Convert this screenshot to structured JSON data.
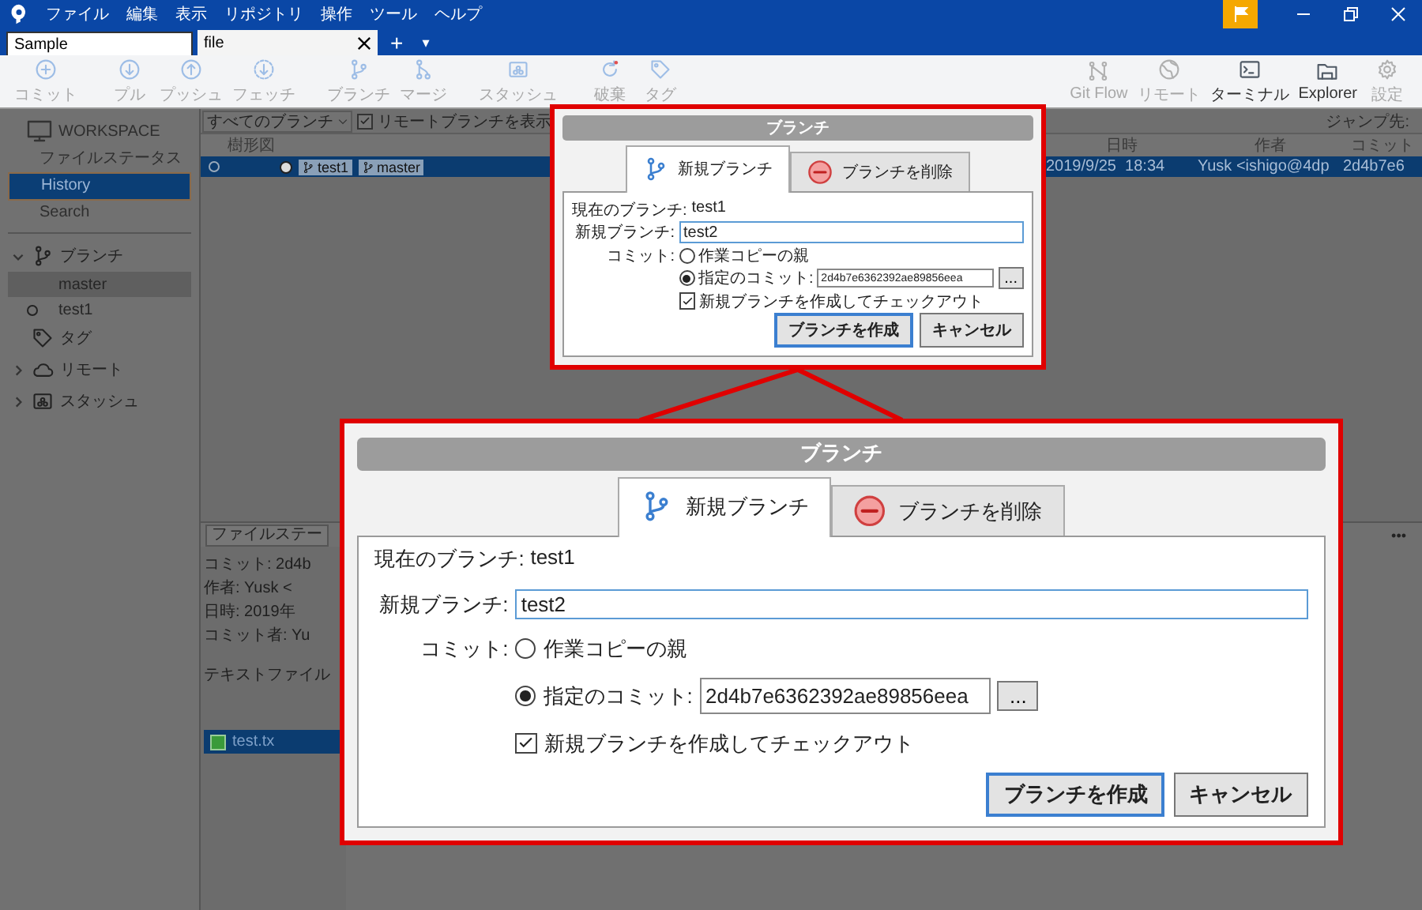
{
  "window": {
    "menu": [
      "ファイル",
      "編集",
      "表示",
      "リポジトリ",
      "操作",
      "ツール",
      "ヘルプ"
    ]
  },
  "tabs": [
    {
      "label": "Sample",
      "selected": false,
      "closable": false
    },
    {
      "label": "file",
      "selected": true,
      "closable": true
    }
  ],
  "tab_actions": [
    "+",
    "▾"
  ],
  "toolbar": {
    "groups": [
      [
        {
          "label": "コミット",
          "kind": "commit",
          "disabled": true
        }
      ],
      [
        {
          "label": "プル",
          "kind": "pull",
          "disabled": true
        },
        {
          "label": "プッシュ",
          "kind": "push",
          "disabled": true
        },
        {
          "label": "フェッチ",
          "kind": "fetch",
          "disabled": true
        }
      ],
      [
        {
          "label": "ブランチ",
          "kind": "branch",
          "disabled": true
        },
        {
          "label": "マージ",
          "kind": "merge",
          "disabled": true
        }
      ],
      [
        {
          "label": "スタッシュ",
          "kind": "stash",
          "disabled": true
        }
      ],
      [
        {
          "label": "破棄",
          "kind": "discard",
          "disabled": true
        },
        {
          "label": "タグ",
          "kind": "tag",
          "disabled": true
        }
      ]
    ],
    "right": [
      {
        "label": "Git Flow",
        "kind": "gitflow",
        "disabled": true
      },
      {
        "label": "リモート",
        "kind": "remote",
        "disabled": true
      },
      {
        "label": "ターミナル",
        "kind": "terminal",
        "disabled": false
      },
      {
        "label": "Explorer",
        "kind": "explorer",
        "disabled": false
      },
      {
        "label": "設定",
        "kind": "settings",
        "disabled": true
      }
    ]
  },
  "sidebar": {
    "workspace": "WORKSPACE",
    "items": [
      {
        "label": "ファイルステータス",
        "selected": false
      },
      {
        "label": "History",
        "selected": true
      },
      {
        "label": "Search",
        "selected": false
      }
    ],
    "sections": [
      {
        "label": "ブランチ",
        "kind": "branch",
        "expanded": true,
        "children": [
          {
            "label": "master",
            "selected": true,
            "current": false
          },
          {
            "label": "test1",
            "selected": false,
            "current": true
          }
        ]
      },
      {
        "label": "タグ",
        "kind": "tag"
      },
      {
        "label": "リモート",
        "kind": "remote",
        "expanded": false
      },
      {
        "label": "スタッシュ",
        "kind": "stash",
        "expanded": false
      }
    ]
  },
  "history": {
    "branch_filter": "すべてのブランチ",
    "show_remote": {
      "label": "リモートブランチを表示",
      "checked": true
    },
    "jump_label": "ジャンプ先:",
    "columns": [
      "樹形図",
      "日時",
      "作者",
      "コミット"
    ],
    "rows": [
      {
        "selected": true,
        "branches": [
          "test1",
          "master"
        ],
        "date": "2019/9/25  18:34",
        "author": "Yusk <ishigo@4dp",
        "commit": "2d4b7e6"
      }
    ]
  },
  "details": {
    "tab": "ファイルステー",
    "lines": [
      "コミット: 2d4b",
      "作者: Yusk <",
      "日時: 2019年",
      "コミット者: Yu"
    ],
    "message": "テキストファイル",
    "files": [
      {
        "name": "test.tx",
        "selected": true
      }
    ],
    "more_button": "•••"
  },
  "dialog": {
    "title": "ブランチ",
    "tabs": [
      {
        "label": "新規ブランチ",
        "kind": "new",
        "selected": true
      },
      {
        "label": "ブランチを削除",
        "kind": "delete",
        "selected": false
      }
    ],
    "current_label": "現在のブランチ:",
    "current_value": "test1",
    "new_label": "新規ブランチ:",
    "new_value": "test2",
    "commit_label": "コミット:",
    "commit_options": [
      {
        "label": "作業コピーの親",
        "selected": false
      },
      {
        "label": "指定のコミット:",
        "selected": true
      }
    ],
    "commit_value": "2d4b7e6362392ae89856eea",
    "browse_button": "...",
    "checkout": {
      "label": "新規ブランチを作成してチェックアウト",
      "checked": true
    },
    "buttons": [
      {
        "label": "ブランチを作成",
        "default": true
      },
      {
        "label": "キャンセル",
        "default": false
      }
    ]
  },
  "zoomed_dialog": {
    "title": "ブランチ",
    "tabs": [
      {
        "label": "新規ブランチ",
        "kind": "new",
        "selected": true
      },
      {
        "label": "ブランチを削除",
        "kind": "delete",
        "selected": false
      }
    ],
    "current_label": "現在のブランチ:",
    "current_value": "test1",
    "new_label": "新規ブランチ:",
    "new_value": "test2",
    "commit_label": "コミット:",
    "commit_options": [
      {
        "label": "作業コピーの親",
        "selected": false
      },
      {
        "label": "指定のコミット:",
        "selected": true
      }
    ],
    "commit_value": "2d4b7e6362392ae89856eea",
    "browse_button": "...",
    "checkout": {
      "label": "新規ブランチを作成してチェックアウト",
      "checked": true
    },
    "buttons": [
      {
        "label": "ブランチを作成",
        "default": true
      },
      {
        "label": "キャンセル",
        "default": false
      }
    ]
  }
}
